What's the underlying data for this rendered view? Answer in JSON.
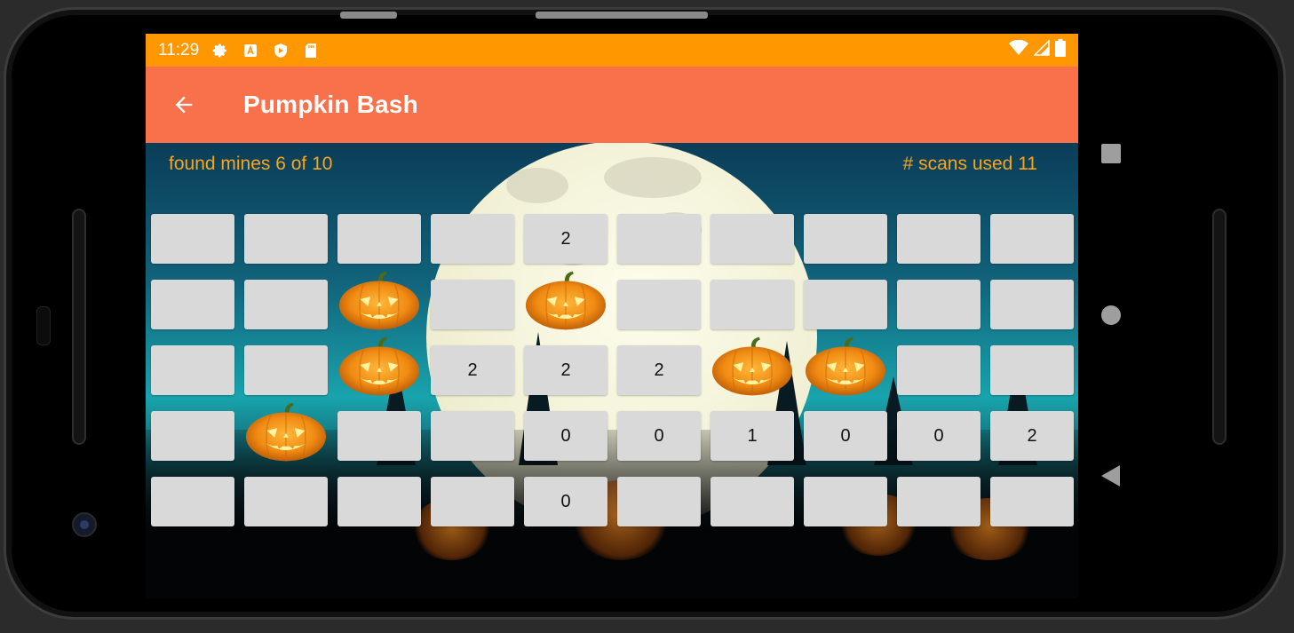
{
  "statusbar": {
    "time": "11:29",
    "icons": [
      "settings-icon",
      "a-badge-icon",
      "shield-play-icon",
      "sd-card-icon",
      "wifi-icon",
      "signal-icon",
      "battery-icon"
    ]
  },
  "appbar": {
    "title": "Pumpkin Bash",
    "back_icon": "arrow-left-icon"
  },
  "game": {
    "found_mines_text": "found mines 6 of 10",
    "scans_used_text": "# scans used 11",
    "grid": [
      [
        "",
        "",
        "",
        "",
        "2",
        "",
        "",
        "",
        "",
        ""
      ],
      [
        "",
        "",
        "M",
        "",
        "M",
        "",
        "",
        "",
        "",
        ""
      ],
      [
        "",
        "",
        "M",
        "2",
        "2",
        "2",
        "M",
        "M",
        "",
        ""
      ],
      [
        "",
        "M",
        "",
        "",
        "0",
        "0",
        "1",
        "0",
        "0",
        "2"
      ],
      [
        "",
        "",
        "",
        "",
        "0",
        "",
        "",
        "",
        "",
        ""
      ]
    ]
  },
  "navbar": {
    "icons": [
      "recents-square-icon",
      "home-circle-icon",
      "back-triangle-icon"
    ]
  },
  "colors": {
    "statusbar": "#ff9800",
    "appbar": "#f9714b",
    "info_text": "#f9a51c",
    "cell": "#d9d9d9"
  }
}
